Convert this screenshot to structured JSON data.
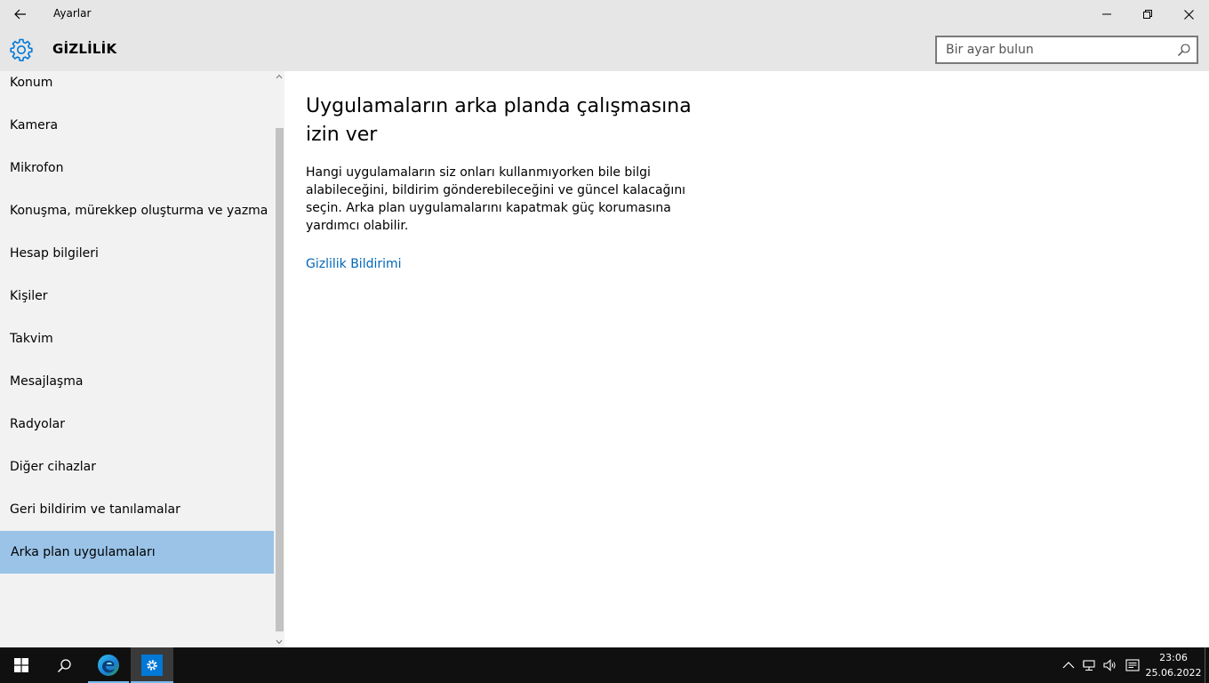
{
  "window": {
    "app_title": "Ayarlar"
  },
  "header": {
    "page_title": "GİZLİLİK",
    "search_placeholder": "Bir ayar bulun"
  },
  "sidebar": {
    "items": [
      {
        "label": "Konum"
      },
      {
        "label": "Kamera"
      },
      {
        "label": "Mikrofon"
      },
      {
        "label": "Konuşma, mürekkep oluşturma ve yazma"
      },
      {
        "label": "Hesap bilgileri"
      },
      {
        "label": "Kişiler"
      },
      {
        "label": "Takvim"
      },
      {
        "label": "Mesajlaşma"
      },
      {
        "label": "Radyolar"
      },
      {
        "label": "Diğer cihazlar"
      },
      {
        "label": "Geri bildirim ve tanılamalar"
      },
      {
        "label": "Arka plan uygulamaları"
      }
    ],
    "selected": "Arka plan uygulamaları"
  },
  "content": {
    "heading": "Uygulamaların arka planda çalışmasına izin ver",
    "description": "Hangi uygulamaların siz onları kullanmıyorken bile bilgi alabileceğini, bildirim gönderebileceğini ve güncel kalacağını seçin. Arka plan uygulamalarını kapatmak güç korumasına yardımcı olabilir.",
    "link": "Gizlilik Bildirimi"
  },
  "taskbar": {
    "time": "23:06",
    "date": "25.06.2022"
  },
  "colors": {
    "accent": "#0078d7",
    "selected_bg": "#9ac3e7",
    "link": "#0067b8",
    "taskbar": "#101010"
  }
}
